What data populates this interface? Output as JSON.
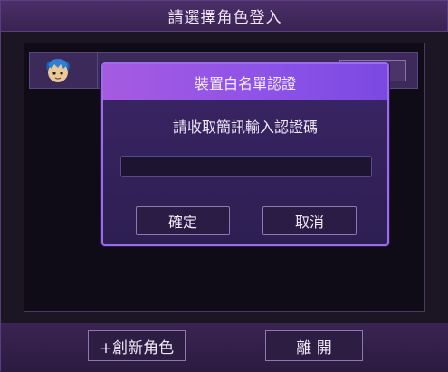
{
  "window": {
    "title": "請選擇角色登入"
  },
  "character_list": {
    "rows": [
      {
        "avatar_icon": "blue-haired-character-avatar-icon"
      }
    ]
  },
  "footer": {
    "create_label": "+創新角色",
    "leave_label": "離 開"
  },
  "dialog": {
    "title": "裝置白名單認證",
    "prompt": "請收取簡訊輸入認證碼",
    "code_value": "",
    "confirm_label": "確定",
    "cancel_label": "取消"
  },
  "colors": {
    "accent": "#9b6bf0",
    "header_gradient_start": "#a55be0",
    "background": "#3a2452"
  }
}
